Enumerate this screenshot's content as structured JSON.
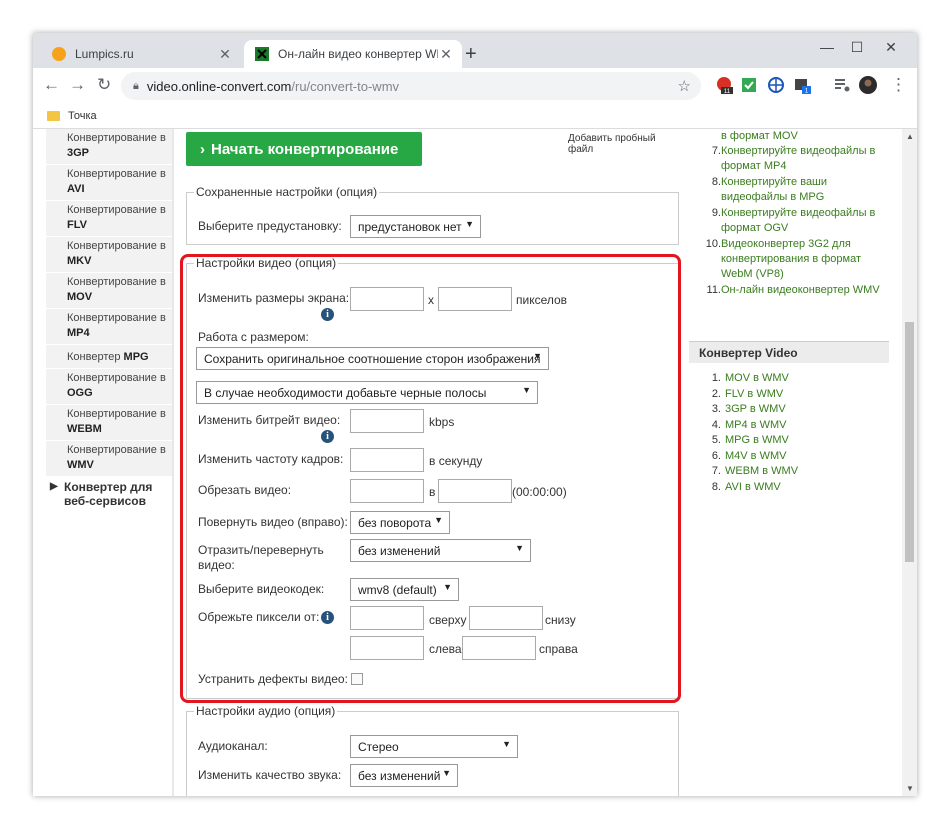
{
  "browser": {
    "tabs": [
      {
        "title": "Lumpics.ru",
        "active": false
      },
      {
        "title": "Он-лайн видео конвертер WMV",
        "active": true
      }
    ],
    "url_host": "video.online-convert.com",
    "url_path": "/ru/convert-to-wmv",
    "bookmark": "Точка",
    "ext_badges": [
      "11",
      "1"
    ]
  },
  "left_nav": {
    "items": [
      {
        "prefix": "Конвертирование в",
        "bold": "3GP"
      },
      {
        "prefix": "Конвертирование в",
        "bold": "AVI"
      },
      {
        "prefix": "Конвертирование в",
        "bold": "FLV"
      },
      {
        "prefix": "Конвертирование в",
        "bold": "MKV"
      },
      {
        "prefix": "Конвертирование в",
        "bold": "MOV"
      },
      {
        "prefix": "Конвертирование в",
        "bold": "MP4"
      },
      {
        "prefix": "Конвертер",
        "bold": "MPG"
      },
      {
        "prefix": "Конвертирование в",
        "bold": "OGG"
      },
      {
        "prefix": "Конвертирование в",
        "bold": "WEBM"
      },
      {
        "prefix": "Конвертирование в",
        "bold": "WMV"
      }
    ],
    "folder": "Конвертер для веб-сервисов"
  },
  "main": {
    "start_button": "Начать конвертирование",
    "add_sample": "Добавить пробный файл",
    "saved": {
      "legend": "Сохраненные настройки (опция)",
      "preset_label": "Выберите предустановку:",
      "preset_value": "предустановок нет"
    },
    "video": {
      "legend": "Настройки видео (опция)",
      "resize_label": "Изменить размеры экрана:",
      "x": "x",
      "pixels": "пикселов",
      "size_handling_label": "Работа с размером:",
      "size_handling_value": "Сохранить оригинальное соотношение сторон изображения",
      "black_bars_value": "В случае необходимости добавьте черные полосы",
      "bitrate_label": "Изменить битрейт видео:",
      "bitrate_unit": "kbps",
      "fps_label": "Изменить частоту кадров:",
      "fps_unit": "в секунду",
      "cut_label": "Обрезать видео:",
      "cut_in": "в",
      "cut_format": "(00:00:00)",
      "rotate_label": "Повернуть видео (вправо):",
      "rotate_value": "без поворота",
      "flip_label": "Отразить/перевернуть видео:",
      "flip_value": "без изменений",
      "codec_label": "Выберите видеокодек:",
      "codec_value": "wmv8 (default)",
      "crop_label": "Обрежьте пиксели от:",
      "crop_top": "сверху",
      "crop_bottom": "снизу",
      "crop_left": "слева",
      "crop_right": "справа",
      "deinterlace_label": "Устранить дефекты видео:"
    },
    "audio": {
      "legend": "Настройки аудио (опция)",
      "channel_label": "Аудиоканал:",
      "channel_value": "Стерео",
      "quality_label": "Изменить качество звука:",
      "quality_value": "без изменений"
    },
    "info_glyph": "i"
  },
  "right": {
    "list_top": [
      {
        "num": "",
        "text": "в формат MOV"
      },
      {
        "num": "7.",
        "text": "Конвертируйте видеофайлы в формат MP4"
      },
      {
        "num": "8.",
        "text": "Конвертируйте ваши видеофайлы в MPG"
      },
      {
        "num": "9.",
        "text": "Конвертируйте видеофайлы в формат OGV"
      },
      {
        "num": "10.",
        "text": "Видеоконвертер 3G2 для конвертирования в формат WebM (VP8)"
      },
      {
        "num": "11.",
        "text": "Он-лайн видеоконвертер WMV"
      }
    ],
    "converter_title": "Конвертер Video",
    "converter_items": [
      {
        "num": "1.",
        "text": "MOV в WMV"
      },
      {
        "num": "2.",
        "text": "FLV в WMV"
      },
      {
        "num": "3.",
        "text": "3GP в WMV"
      },
      {
        "num": "4.",
        "text": "MP4 в WMV"
      },
      {
        "num": "5.",
        "text": "MPG в WMV"
      },
      {
        "num": "6.",
        "text": "M4V в WMV"
      },
      {
        "num": "7.",
        "text": "WEBM в WMV"
      },
      {
        "num": "8.",
        "text": "AVI в WMV"
      }
    ]
  },
  "colors": {
    "accent_green": "#28a745",
    "highlight_red": "#e3161f",
    "link_green": "#3a7d1e"
  }
}
